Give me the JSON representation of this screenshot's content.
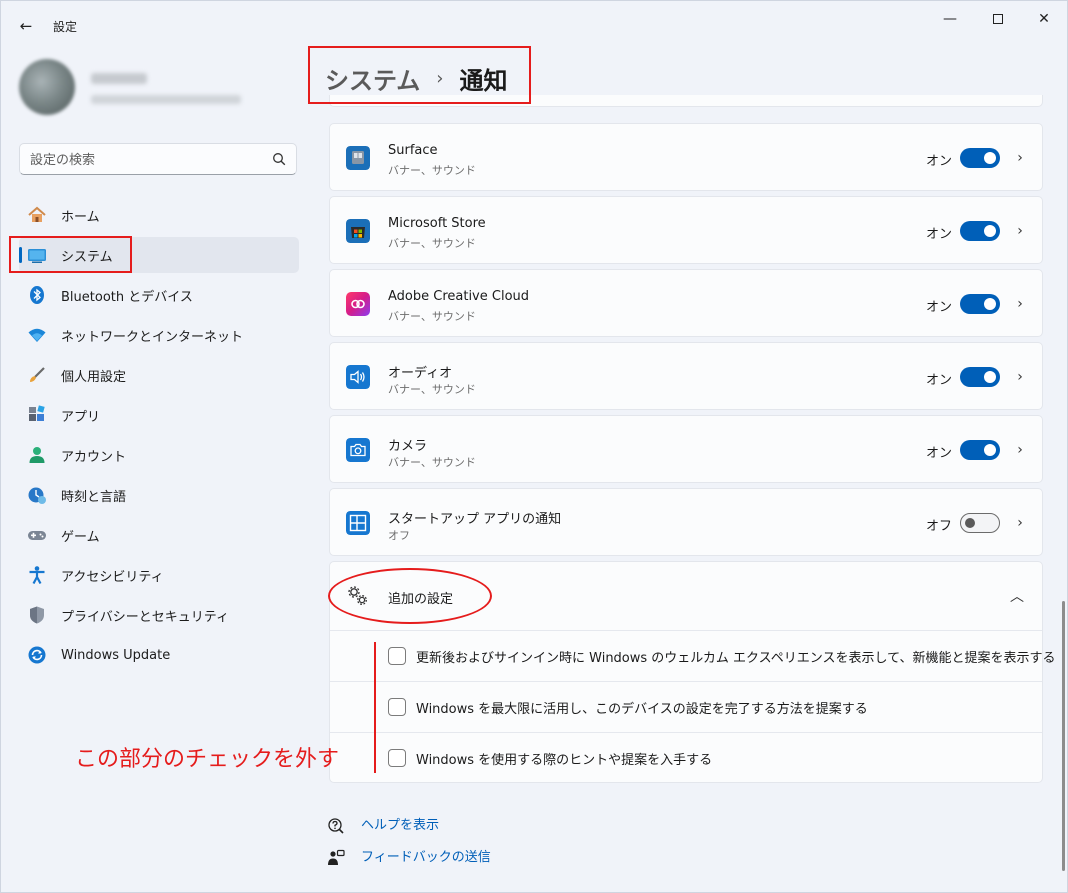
{
  "window": {
    "title": "設定",
    "back_icon": "←",
    "min_icon": "—",
    "close_icon": "✕"
  },
  "search": {
    "placeholder": "設定の検索"
  },
  "nav": [
    {
      "label": "ホーム",
      "icon": "home-icon",
      "active": false
    },
    {
      "label": "システム",
      "icon": "system-icon",
      "active": true
    },
    {
      "label": "Bluetooth とデバイス",
      "icon": "bluetooth-icon",
      "active": false
    },
    {
      "label": "ネットワークとインターネット",
      "icon": "wifi-icon",
      "active": false
    },
    {
      "label": "個人用設定",
      "icon": "brush-icon",
      "active": false
    },
    {
      "label": "アプリ",
      "icon": "apps-icon",
      "active": false
    },
    {
      "label": "アカウント",
      "icon": "account-icon",
      "active": false
    },
    {
      "label": "時刻と言語",
      "icon": "time-language-icon",
      "active": false
    },
    {
      "label": "ゲーム",
      "icon": "gamepad-icon",
      "active": false
    },
    {
      "label": "アクセシビリティ",
      "icon": "accessibility-icon",
      "active": false
    },
    {
      "label": "プライバシーとセキュリティ",
      "icon": "shield-icon",
      "active": false
    },
    {
      "label": "Windows Update",
      "icon": "update-icon",
      "active": false
    }
  ],
  "breadcrumb": {
    "parent": "システム",
    "separator": "›",
    "current": "通知"
  },
  "apps": [
    {
      "name": "Surface",
      "sub": "バナー、サウンド",
      "state": "オン",
      "on": true,
      "icon": "surface-icon"
    },
    {
      "name": "Microsoft Store",
      "sub": "バナー、サウンド",
      "state": "オン",
      "on": true,
      "icon": "store-icon"
    },
    {
      "name": "Adobe Creative Cloud",
      "sub": "バナー、サウンド",
      "state": "オン",
      "on": true,
      "icon": "creative-cloud-icon"
    },
    {
      "name": "オーディオ",
      "sub": "バナー、サウンド",
      "state": "オン",
      "on": true,
      "icon": "audio-icon"
    },
    {
      "name": "カメラ",
      "sub": "バナー、サウンド",
      "state": "オン",
      "on": true,
      "icon": "camera-icon"
    },
    {
      "name": "スタートアップ アプリの通知",
      "sub": "オフ",
      "state": "オフ",
      "on": false,
      "icon": "startup-icon"
    }
  ],
  "additional": {
    "title": "追加の設定",
    "chevron": "︿",
    "options": [
      {
        "label": "更新後およびサインイン時に Windows のウェルカム エクスペリエンスを表示して、新機能と提案を表示する",
        "checked": false
      },
      {
        "label": "Windows を最大限に活用し、このデバイスの設定を完了する方法を提案する",
        "checked": false
      },
      {
        "label": "Windows を使用する際のヒントや提案を入手する",
        "checked": false
      }
    ]
  },
  "links": {
    "help": "ヘルプを表示",
    "feedback": "フィードバックの送信"
  },
  "annotation": {
    "text": "この部分のチェックを外す",
    "color": "#e51c1c"
  },
  "colors": {
    "accent": "#005fb8",
    "indicator": "#0067c0"
  }
}
